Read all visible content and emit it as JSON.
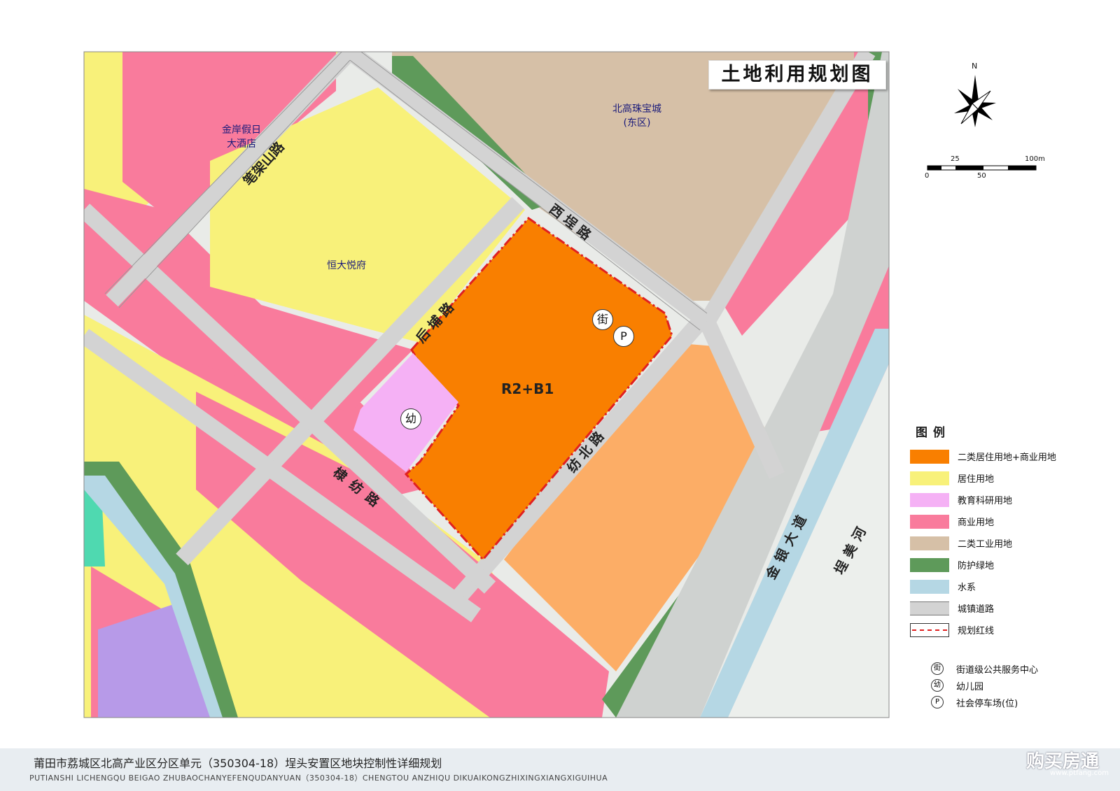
{
  "map": {
    "title": "土地利用规划图",
    "zone_code": "R2+B1",
    "places": {
      "hotel": [
        "金岸假日",
        "大酒店"
      ],
      "jewelry": [
        "北高珠宝城",
        "(东区)"
      ],
      "hengda": "恒大悦府"
    },
    "roads": {
      "lijiashan": "笔架山路",
      "xitan": "西埕路",
      "houpu": "后埔路",
      "fangbei": "纺北路",
      "lifang": "棣纺路",
      "jinyin": "金银大道",
      "river": "埕美河"
    },
    "symbols": {
      "street": "街",
      "parking": "P",
      "kinder": "幼"
    },
    "compass": {
      "north": "N"
    },
    "scale": {
      "labels_top": [
        "25",
        "100m"
      ],
      "labels_bottom": [
        "0",
        "50"
      ]
    }
  },
  "legend": {
    "title": "图例",
    "items": [
      {
        "label": "二类居住用地+商业用地",
        "color": "#f97f00"
      },
      {
        "label": "居住用地",
        "color": "#f8f17a"
      },
      {
        "label": "教育科研用地",
        "color": "#f5b1f5"
      },
      {
        "label": "商业用地",
        "color": "#f97b9c"
      },
      {
        "label": "二类工业用地",
        "color": "#d6c0a7"
      },
      {
        "label": "防护绿地",
        "color": "#5e9a5a"
      },
      {
        "label": "水系",
        "color": "#b5d7e4"
      },
      {
        "label": "城镇道路",
        "color": "#d3d3d3"
      },
      {
        "label": "规划红线",
        "color": "#e02020"
      }
    ],
    "symbols": [
      {
        "icon": "街",
        "label": "街道级公共服务中心"
      },
      {
        "icon": "幼",
        "label": "幼儿园"
      },
      {
        "icon": "P",
        "label": "社会停车场(位)"
      }
    ]
  },
  "footer": {
    "title_cn": "莆田市荔城区北高产业区分区单元（350304-18）埕头安置区地块控制性详细规划",
    "title_en": "PUTIANSHI LICHENGQU BEIGAO ZHUBAOCHANYEFENQUDANYUAN（350304-18）CHENGTOU ANZHIQU DIKUAIKONGZHIXINGXIANGXIGUIHUA",
    "brand": "购买房通",
    "brand_url": "www.ptfang.com"
  }
}
